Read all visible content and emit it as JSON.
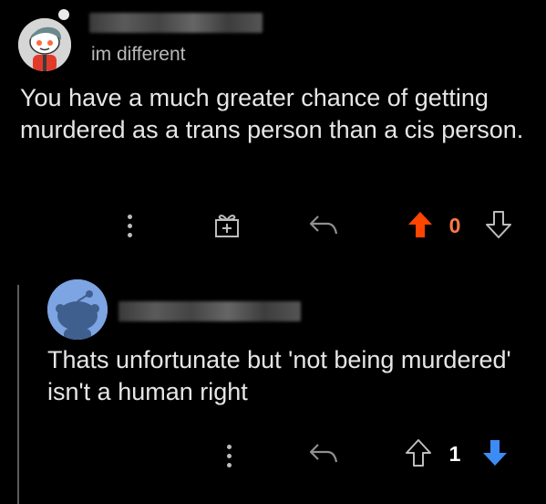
{
  "parent_comment": {
    "flair": "im different",
    "body": "You have a much greater chance of getting murdered as a trans person than a cis person.",
    "score": "0",
    "upvoted": true,
    "avatar_icon": "snoo-avatar-icon",
    "icons": [
      "more-options-icon",
      "award-icon",
      "reply-icon",
      "upvote-icon",
      "downvote-icon"
    ]
  },
  "child_comment": {
    "body": "Thats unfortunate but 'not being murdered' isn't a human right",
    "score": "1",
    "downvoted": true,
    "avatar_icon": "default-snoo-avatar-icon",
    "icons": [
      "more-options-icon",
      "reply-icon",
      "upvote-icon",
      "downvote-icon"
    ]
  },
  "colors": {
    "background": "#000000",
    "upvote_active": "#ff4500",
    "downvote_active": "#3d8cf5",
    "score_upvoted": "#ff7a45",
    "icon_default": "#bdbdbd"
  }
}
